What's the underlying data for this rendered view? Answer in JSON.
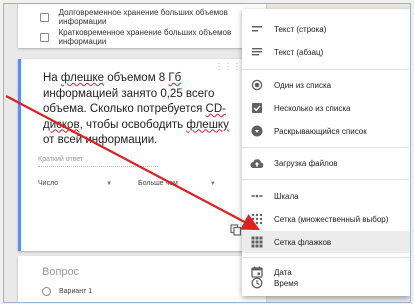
{
  "top_options": [
    "Долговременное хранение больших объемов информации",
    "Кратковременное хранение больших объемов информации"
  ],
  "question": {
    "text_before_1": "На ",
    "text_err_1": "флешке",
    "text_mid_1": " объемом 8 ",
    "text_err_2": "Гб",
    "text_mid_2": " информацией занято 0,25 всего объема. Сколько потребуется ",
    "text_err_3": "CD-дисков",
    "text_mid_3": ", чтобы освободить ",
    "text_err_4": "флешку",
    "text_end": " от всей информации.",
    "answer_placeholder": "Краткий ответ",
    "validation_type": "Число",
    "validation_rule": "Больше чем"
  },
  "next_section": {
    "label": "Вопрос",
    "option": "Вариант 1"
  },
  "menu": {
    "items": [
      {
        "label": "Текст (строка)",
        "icon": "short-text-icon"
      },
      {
        "label": "Текст (абзац)",
        "icon": "paragraph-icon"
      },
      {
        "label": "Один из списка",
        "icon": "radio-icon"
      },
      {
        "label": "Несколько из списка",
        "icon": "checkbox-icon"
      },
      {
        "label": "Раскрывающийся список",
        "icon": "dropdown-icon"
      },
      {
        "label": "Загрузка файлов",
        "icon": "upload-icon"
      },
      {
        "label": "Шкала",
        "icon": "scale-icon"
      },
      {
        "label": "Сетка (множественный выбор)",
        "icon": "grid-dots-icon"
      },
      {
        "label": "Сетка флажков",
        "icon": "grid-checkbox-icon"
      },
      {
        "label": "Дата",
        "icon": "calendar-icon"
      },
      {
        "label": "Время",
        "icon": "clock-icon"
      }
    ],
    "active_index": 8
  },
  "colors": {
    "accent": "#5c8df6",
    "arrow": "#e02020",
    "icon_gray": "#616161"
  }
}
